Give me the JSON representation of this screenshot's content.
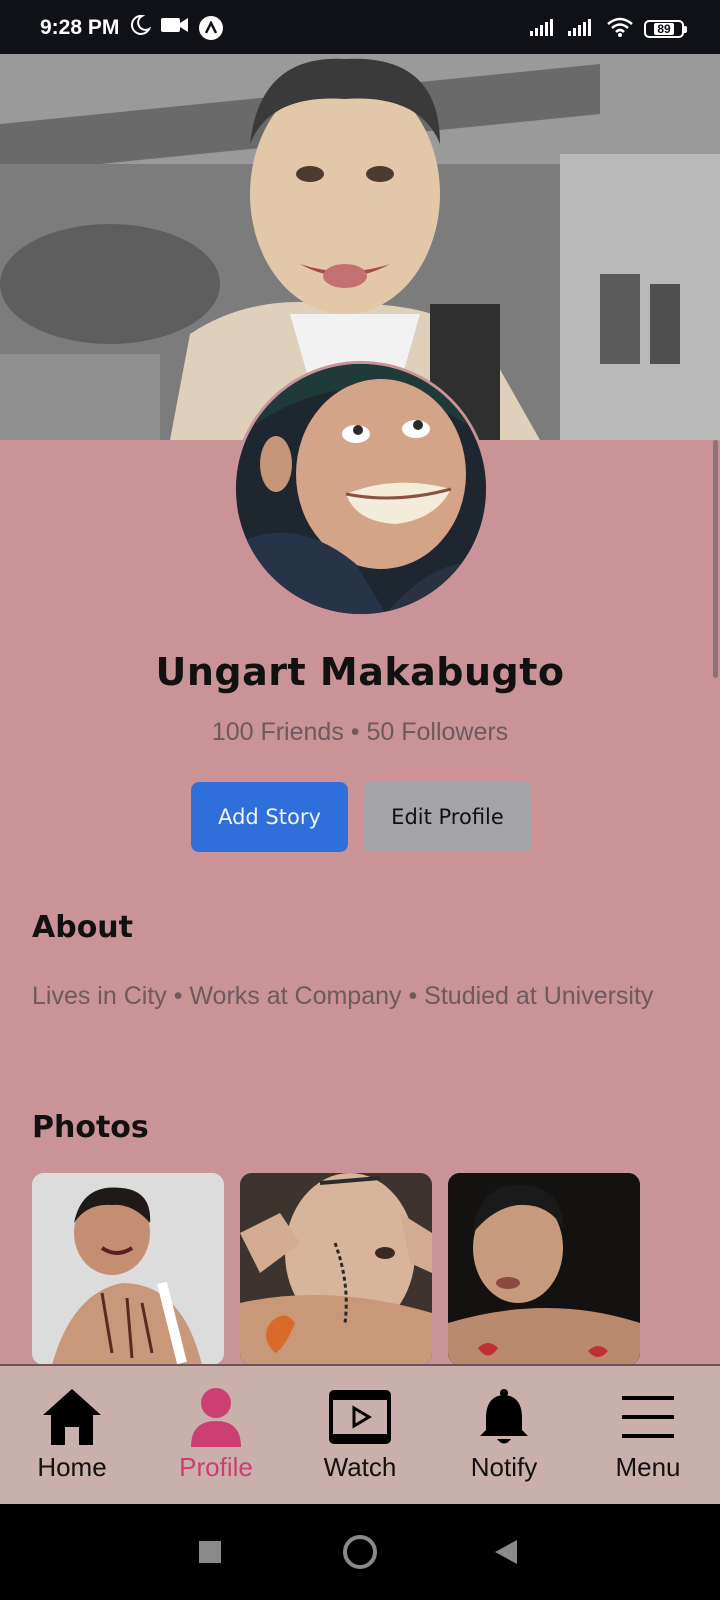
{
  "status_bar": {
    "time": "9:28 PM",
    "battery": "89",
    "icons": [
      "moon-icon",
      "video-icon",
      "app-badge-icon",
      "signal-icon",
      "signal-icon",
      "wifi-icon",
      "battery-icon"
    ]
  },
  "profile": {
    "name": "Ungart Makabugto",
    "stats": "100 Friends • 50 Followers",
    "add_story_label": "Add Story",
    "edit_profile_label": "Edit Profile"
  },
  "about": {
    "title": "About",
    "text": "Lives in City • Works at Company • Studied at University"
  },
  "photos": {
    "title": "Photos",
    "count_visible": 3
  },
  "bottom_nav": {
    "items": [
      {
        "label": "Home",
        "icon": "home-icon",
        "active": false
      },
      {
        "label": "Profile",
        "icon": "person-icon",
        "active": true
      },
      {
        "label": "Watch",
        "icon": "video-play-icon",
        "active": false
      },
      {
        "label": "Notify",
        "icon": "bell-icon",
        "active": false
      },
      {
        "label": "Menu",
        "icon": "hamburger-menu-icon",
        "active": false
      }
    ]
  },
  "colors": {
    "page_background": "#c99398",
    "primary_button": "#2f6fd9",
    "secondary_button": "#a3a3a8",
    "active_nav": "#cc3f73",
    "nav_background": "#c9b0ad"
  }
}
